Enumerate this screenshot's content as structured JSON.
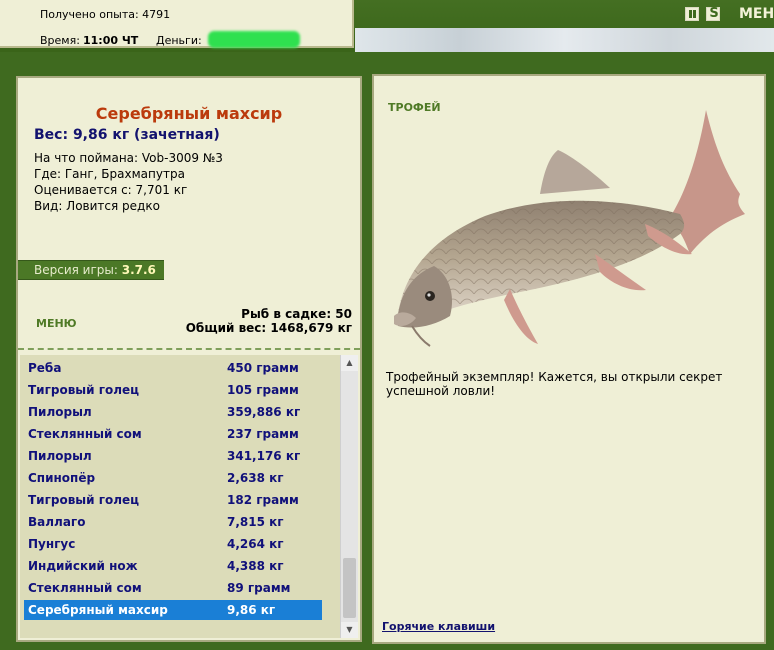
{
  "stats": {
    "experience_text": "Получено опыта: 4791",
    "time_label": "Время:",
    "time_value": "11:00 ЧТ",
    "money_label": "Деньги:"
  },
  "top_controls": {
    "pause_icon": "pause-icon",
    "sound_icon": "sound-icon",
    "sound_glyph": "S",
    "menu_label": "МЕНЮ"
  },
  "fish": {
    "name": "Серебряный махсир",
    "weight": "Вес: 9,86 кг (зачетная)",
    "bait": "На что поймана: Vob-3009 №3",
    "place": "Где: Ганг, Брахмапутра",
    "estimate": "Оценивается с: 7,701 кг",
    "kind": "Вид: Ловится редко"
  },
  "version": {
    "label": "Версия игры:",
    "value": "3.7.6"
  },
  "left_menu": {
    "menu_label": "МЕНЮ"
  },
  "keepnet": {
    "count_text": "Рыб в садке: 50",
    "total_weight_text": "Общий вес: 1468,679 кг"
  },
  "catch_list": [
    {
      "name": "Реба",
      "weight": "450 грамм"
    },
    {
      "name": "Тигровый голец",
      "weight": "105 грамм"
    },
    {
      "name": "Пилорыл",
      "weight": "359,886 кг"
    },
    {
      "name": "Стеклянный сом",
      "weight": "237 грамм"
    },
    {
      "name": "Пилорыл",
      "weight": "341,176 кг"
    },
    {
      "name": "Спинопёр",
      "weight": "2,638 кг"
    },
    {
      "name": "Тигровый голец",
      "weight": "182 грамм"
    },
    {
      "name": "Валлаго",
      "weight": "7,815 кг"
    },
    {
      "name": "Пунгус",
      "weight": "4,264 кг"
    },
    {
      "name": "Индийский нож",
      "weight": "4,388 кг"
    },
    {
      "name": "Стеклянный сом",
      "weight": "89 грамм"
    },
    {
      "name": "Серебряный махсир",
      "weight": "9,86 кг"
    }
  ],
  "catch_selected_index": 11,
  "trophy": {
    "label": "ТРОФЕЙ",
    "text": "Трофейный экземпляр! Кажется, вы открыли секрет успешной ловли!",
    "hotkeys_label": "Горячие клавиши"
  },
  "colors": {
    "background": "#3f6a1f",
    "panel": "#efefd6",
    "fish_name": "#bb3a0c",
    "list_text": "#11117a",
    "selected_row": "#1a7fd6",
    "menu_green": "#4f7a26"
  }
}
